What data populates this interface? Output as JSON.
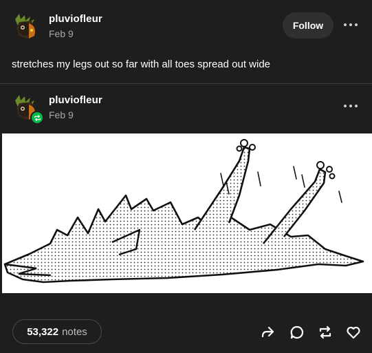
{
  "post": {
    "author": "pluviofleur",
    "date": "Feb 9",
    "follow_label": "Follow",
    "body_text": "stretches my legs out so far with all toes spread out wide"
  },
  "reblog": {
    "author": "pluviofleur",
    "date": "Feb 9"
  },
  "footer": {
    "notes_count": "53,322",
    "notes_label": "notes"
  },
  "icons": {
    "more": "more-options-icon",
    "reblog_badge": "reblog-badge-icon",
    "share": "share-icon",
    "reply": "reply-icon",
    "reblog": "reblog-icon",
    "like": "heart-icon"
  },
  "colors": {
    "background": "#1e1e1e",
    "reblog_badge": "#00b84a",
    "muted_text": "#a8a8a8"
  }
}
